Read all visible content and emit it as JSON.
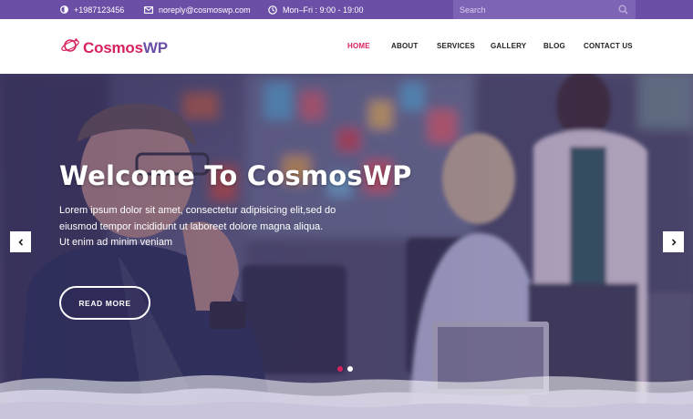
{
  "topbar": {
    "phone": "+1987123456",
    "email": "noreply@cosmoswp.com",
    "hours": "Mon–Fri : 9:00 - 19:00",
    "search_placeholder": "Search",
    "icons": [
      "half-circle-icon",
      "envelope-icon",
      "clock-icon",
      "search-icon"
    ]
  },
  "logo": {
    "part1": "Cosmos",
    "part2": "WP",
    "icon": "planet-icon"
  },
  "nav": {
    "items": [
      {
        "label": "HOME",
        "active": true
      },
      {
        "label": "ABOUT"
      },
      {
        "label": "SERVICES"
      },
      {
        "label": "GALLERY"
      },
      {
        "label": "BLOG"
      },
      {
        "label": "CONTACT US"
      }
    ]
  },
  "hero": {
    "title": "Welcome To CosmosWP",
    "text_lines": [
      "Lorem ipsum dolor sit amet, consectetur adipisicing elit,sed do",
      "eiusmod tempor incididunt ut laboreet dolore magna aliqua.",
      "Ut enim ad minim veniam"
    ],
    "button_label": "READ MORE",
    "prev_icon": "chevron-left-icon",
    "next_icon": "chevron-right-icon",
    "slides_total": 2,
    "active_slide": 1
  },
  "colors": {
    "topbar": "#6b4fa6",
    "accent": "#d6225f",
    "brand_purple": "#6b4fa6"
  }
}
